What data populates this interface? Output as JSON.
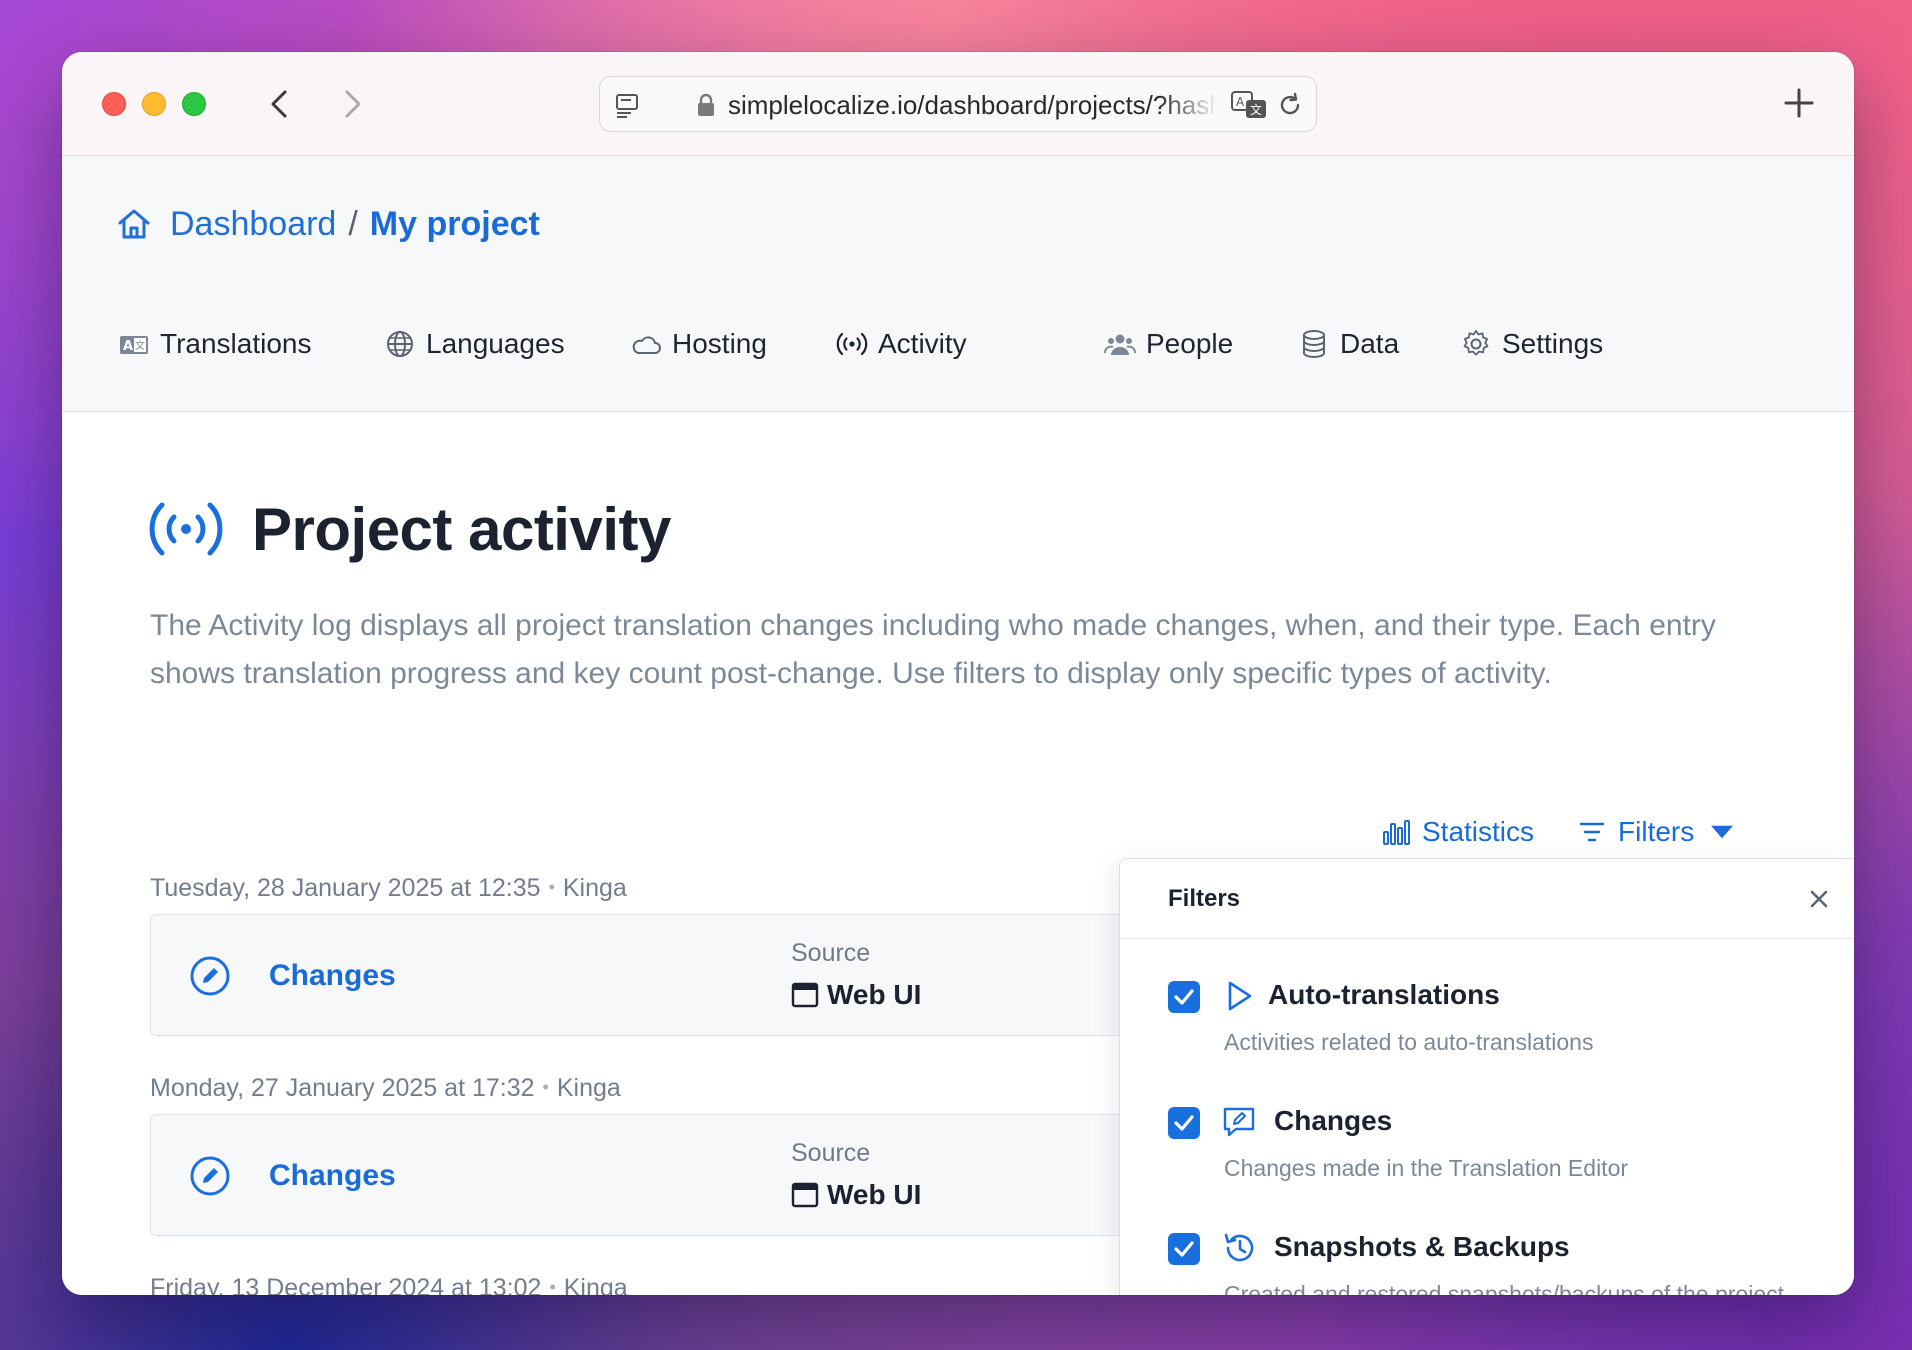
{
  "browser": {
    "url": "simplelocalize.io/dashboard/projects/?hash=activity"
  },
  "breadcrumb": {
    "home_label": "Dashboard",
    "separator": "/",
    "current": "My project"
  },
  "tabs": [
    {
      "label": "Translations",
      "icon": "translate-badge-icon",
      "active": false
    },
    {
      "label": "Languages",
      "icon": "globe-icon",
      "active": false
    },
    {
      "label": "Hosting",
      "icon": "cloud-icon",
      "active": false
    },
    {
      "label": "Activity",
      "icon": "broadcast-icon",
      "active": true
    },
    {
      "label": "People",
      "icon": "people-icon",
      "active": false
    },
    {
      "label": "Data",
      "icon": "database-icon",
      "active": false
    },
    {
      "label": "Settings",
      "icon": "gear-icon",
      "active": false
    }
  ],
  "page": {
    "title": "Project activity",
    "description": "The Activity log displays all project translation changes including who made changes, when, and their type. Each entry shows translation progress and key count post-change. Use filters to display only specific types of activity."
  },
  "toolbar": {
    "statistics_label": "Statistics",
    "filters_label": "Filters"
  },
  "entries": [
    {
      "date": "Tuesday, 28 January 2025 at 12:35",
      "user": "Kinga",
      "title": "Changes",
      "source_label": "Source",
      "source_value": "Web UI"
    },
    {
      "date": "Monday, 27 January 2025 at 17:32",
      "user": "Kinga",
      "title": "Changes",
      "source_label": "Source",
      "source_value": "Web UI"
    },
    {
      "date": "Friday, 13 December 2024 at 13:02",
      "user": "Kinga"
    }
  ],
  "filters_panel": {
    "title": "Filters",
    "items": [
      {
        "label": "Auto-translations",
        "description": "Activities related to auto-translations",
        "checked": true,
        "icon": "play-icon"
      },
      {
        "label": "Changes",
        "description": "Changes made in the Translation Editor",
        "checked": true,
        "icon": "edit-message-icon"
      },
      {
        "label": "Snapshots & Backups",
        "description": "Created and restored snapshots/backups of the project",
        "checked": true,
        "icon": "history-icon"
      }
    ]
  },
  "colors": {
    "accent": "#1a6fdf",
    "text": "#1d2230",
    "muted": "#7d8897"
  }
}
